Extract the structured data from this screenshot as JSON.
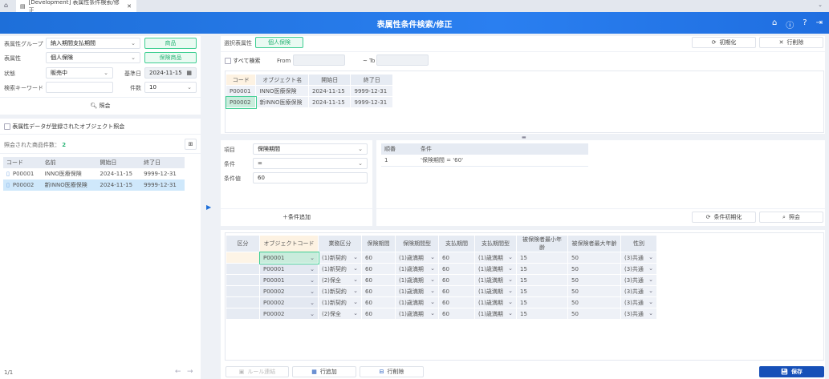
{
  "tab": {
    "title": "[Development] 表属性条件検索/修正"
  },
  "header": {
    "title": "表属性条件検索/修正"
  },
  "left": {
    "group_label": "表属性グループ",
    "group_value": "納入期間支払期間",
    "group_btn": "商品",
    "attr_label": "表属性",
    "attr_value": "個人保険",
    "attr_btn": "保険商品",
    "status_label": "状態",
    "status_value": "販売中",
    "date_label": "基準日",
    "date_value": "2024-11-15",
    "keyword_label": "検索キーワード",
    "keyword_value": "",
    "count_label": "件数",
    "count_value": "10",
    "search_btn": "照会",
    "registered_label": "表属性データが登録されたオブジェクト照会",
    "result_label": "照会された商品件数：",
    "result_count": "2",
    "table": {
      "headers": [
        "コード",
        "名前",
        "開始日",
        "終了日"
      ],
      "rows": [
        [
          "P00001",
          "INNO医療保険",
          "2024-11-15",
          "9999-12-31"
        ],
        [
          "P00002",
          "新INNO医療保険",
          "2024-11-15",
          "9999-12-31"
        ]
      ]
    },
    "pager": "1/1"
  },
  "right": {
    "selected_label": "選択表属性",
    "selected_value": "個人保険",
    "init_btn": "初期化",
    "delrow_btn": "行削除",
    "all_search_label": "すべて検索",
    "from_label": "From",
    "to_label": "~ To",
    "obj_table": {
      "headers": [
        "コード",
        "オブジェクト名",
        "開始日",
        "終了日"
      ],
      "rows": [
        [
          "P00001",
          "INNO医療保険",
          "2024-11-15",
          "9999-12-31"
        ],
        [
          "P00002",
          "新INNO医療保険",
          "2024-11-15",
          "9999-12-31"
        ]
      ]
    },
    "cond": {
      "item_label": "項目",
      "item_value": "保険期間",
      "op_label": "条件",
      "op_value": "=",
      "val_label": "条件値",
      "val_value": "60",
      "add_btn": "条件追加",
      "table": {
        "headers": [
          "順番",
          "条件"
        ],
        "rows": [
          [
            "1",
            "'保険期間 = '60'"
          ]
        ]
      },
      "reset_btn": "条件初期化",
      "search_btn": "照会"
    },
    "grid": {
      "headers": [
        "区分",
        "オブジェクトコード",
        "業務区分",
        "保険期間",
        "保険期間型",
        "支払期間",
        "支払期間型",
        "被保険者最小年齢",
        "被保険者最大年齢",
        "性別"
      ],
      "rows": [
        [
          "",
          "P00001",
          "(1)新契約",
          "60",
          "(1)歳満期",
          "60",
          "(1)歳満期",
          "15",
          "50",
          "(3)共通"
        ],
        [
          "",
          "P00001",
          "(1)新契約",
          "60",
          "(1)歳満期",
          "60",
          "(1)歳満期",
          "15",
          "50",
          "(3)共通"
        ],
        [
          "",
          "P00001",
          "(2)保全",
          "60",
          "(1)歳満期",
          "60",
          "(1)歳満期",
          "15",
          "50",
          "(3)共通"
        ],
        [
          "",
          "P00002",
          "(1)新契約",
          "60",
          "(1)歳満期",
          "60",
          "(1)歳満期",
          "15",
          "50",
          "(3)共通"
        ],
        [
          "",
          "P00002",
          "(1)新契約",
          "60",
          "(1)歳満期",
          "60",
          "(1)歳満期",
          "15",
          "50",
          "(3)共通"
        ],
        [
          "",
          "P00002",
          "(2)保全",
          "60",
          "(1)歳満期",
          "60",
          "(1)歳満期",
          "15",
          "50",
          "(3)共通"
        ]
      ]
    },
    "rule_btn": "ルール連結",
    "addrow_btn": "行追加",
    "delrow2_btn": "行削除",
    "save_btn": "保存"
  },
  "colors": {
    "accent": "#1e6fd9",
    "green": "#2bb477",
    "save": "#1750b8"
  }
}
